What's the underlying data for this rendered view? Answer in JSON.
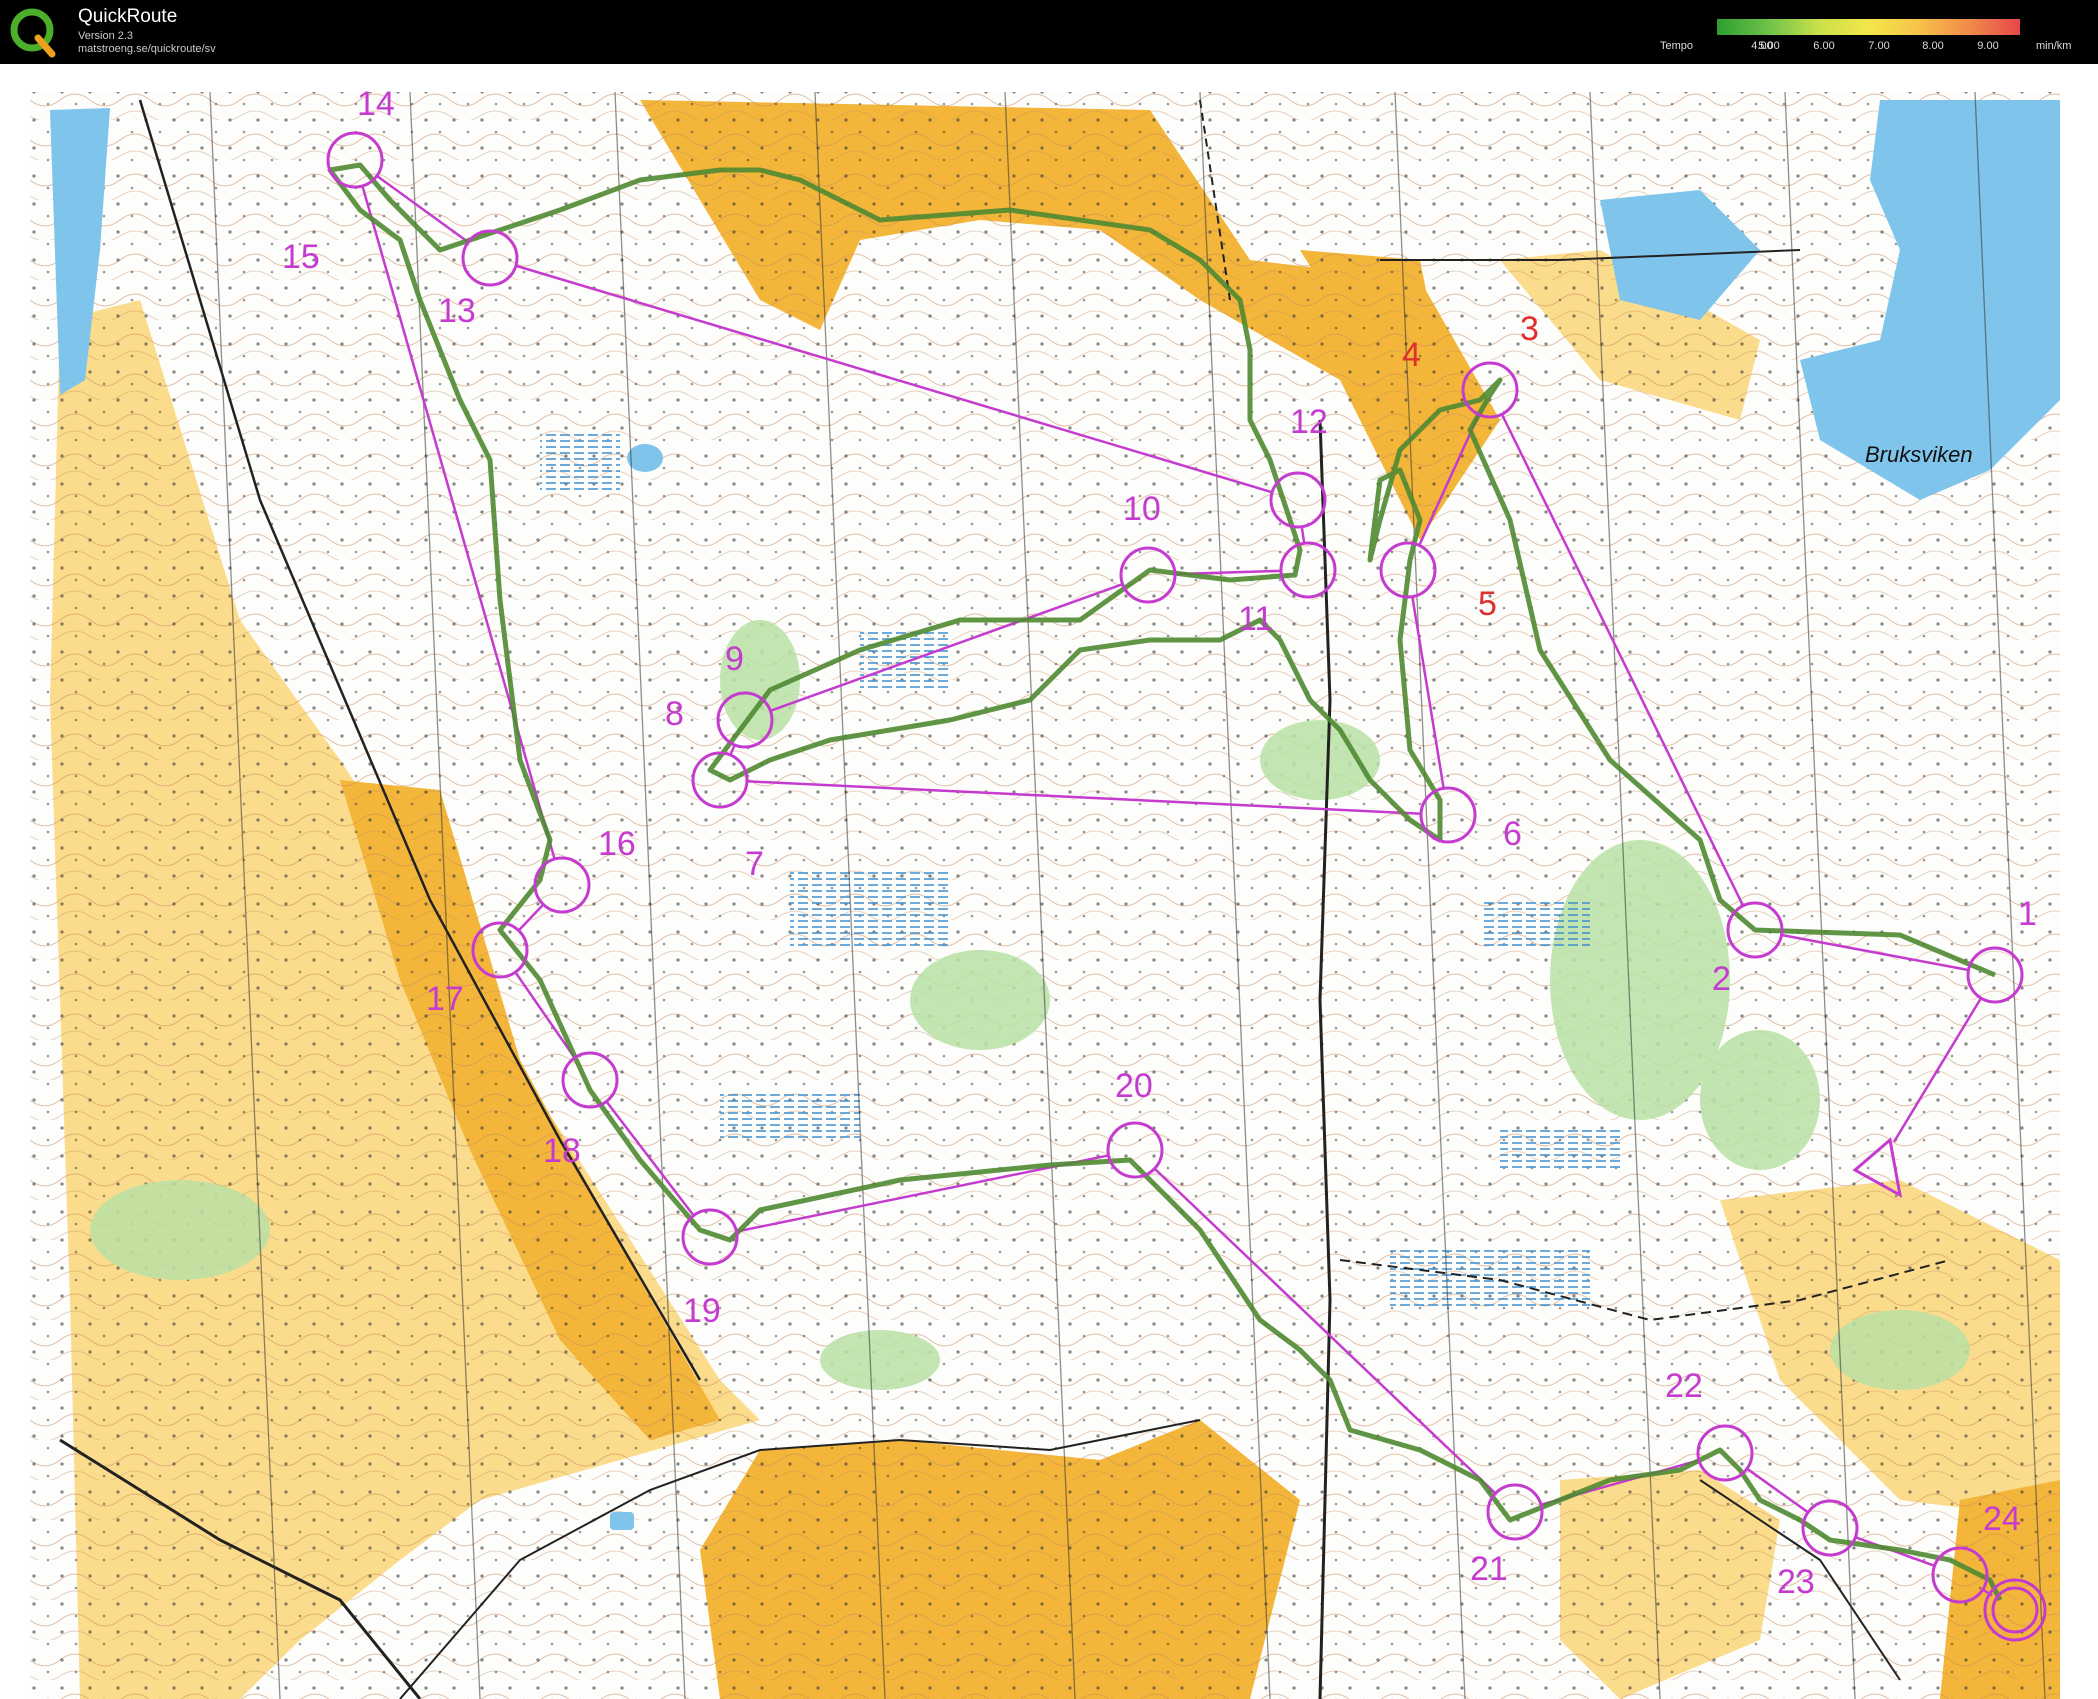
{
  "app": {
    "title": "QuickRoute",
    "version": "Version 2.3",
    "url": "matstroeng.se/quickroute/sv",
    "logo_icon": "quickroute-q-logo-icon"
  },
  "tempo_legend": {
    "label": "Tempo",
    "ticks": [
      "4.00",
      "5.00",
      "6.00",
      "7.00",
      "8.00",
      "9.00"
    ],
    "unit": "min/km",
    "colors": [
      "#2e9e2e",
      "#6cc24a",
      "#c8e04a",
      "#f4e64a",
      "#f6c24a",
      "#f08a4a",
      "#e8474a"
    ]
  },
  "map": {
    "place_names": [
      "Bruksviken"
    ],
    "controls": [
      {
        "num": "1"
      },
      {
        "num": "2"
      },
      {
        "num": "3"
      },
      {
        "num": "4"
      },
      {
        "num": "5"
      },
      {
        "num": "6"
      },
      {
        "num": "7"
      },
      {
        "num": "8"
      },
      {
        "num": "9"
      },
      {
        "num": "10"
      },
      {
        "num": "11"
      },
      {
        "num": "12"
      },
      {
        "num": "13"
      },
      {
        "num": "14"
      },
      {
        "num": "15"
      },
      {
        "num": "16"
      },
      {
        "num": "17"
      },
      {
        "num": "18"
      },
      {
        "num": "19"
      },
      {
        "num": "20"
      },
      {
        "num": "21"
      },
      {
        "num": "22"
      },
      {
        "num": "23"
      },
      {
        "num": "24"
      }
    ],
    "colors": {
      "course": "#c53bd0",
      "route": "#4f8a32",
      "water": "#7fc4ea",
      "open_land": "#f3b63a",
      "rough_open": "#fbdc8c",
      "green": "#b8e0a4"
    }
  }
}
